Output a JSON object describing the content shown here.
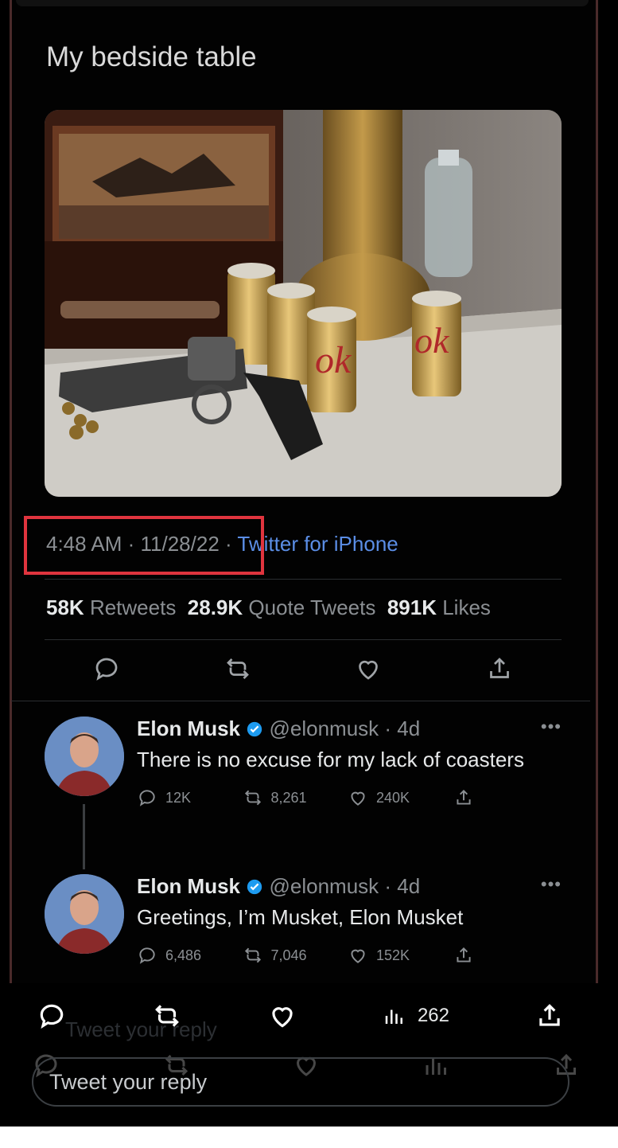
{
  "tweet": {
    "text": "My bedside table",
    "time_date": "4:48 AM · 11/28/22",
    "separator": " · ",
    "source": "Twitter for iPhone",
    "retweets_count": "58K",
    "retweets_label": "Retweets",
    "quotes_count": "28.9K",
    "quotes_label": "Quote Tweets",
    "likes_count": "891K",
    "likes_label": "Likes"
  },
  "replies": [
    {
      "name": "Elon Musk",
      "handle_time": "@elonmusk · 4d",
      "text": "There is no excuse for my lack of coasters",
      "reply_count": "12K",
      "retweet_count": "8,261",
      "like_count": "240K"
    },
    {
      "name": "Elon Musk",
      "handle_time": "@elonmusk · 4d",
      "text": "Greetings, I’m Musket, Elon Musket",
      "reply_count": "6,486",
      "retweet_count": "7,046",
      "like_count": "152K"
    }
  ],
  "bottom": {
    "views": "262",
    "reply_placeholder": "Tweet your reply",
    "ghost_text": "Tweet your reply"
  },
  "colors": {
    "highlight": "#e0343e",
    "link": "#5b8ee6",
    "verified": "#1d9bf0"
  }
}
